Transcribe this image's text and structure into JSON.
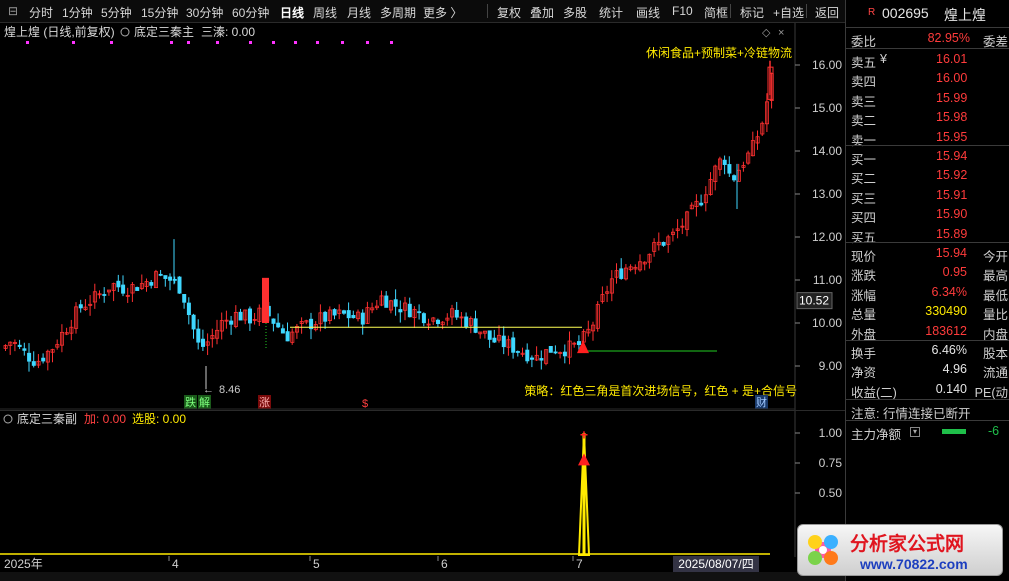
{
  "toolbar": {
    "items": [
      "分时",
      "1分钟",
      "5分钟",
      "15分钟",
      "30分钟",
      "60分钟",
      "日线",
      "周线",
      "月线",
      "多周期",
      "更多 〉",
      "复权",
      "叠加",
      "多股",
      "统计",
      "画线",
      "F10",
      "简框",
      "标记",
      "+自选",
      "返回"
    ],
    "active": "日线"
  },
  "main": {
    "stock_label": "煌上煌 (日线,前复权)",
    "indicator_name": "底定三秦主",
    "indicator_value": "三溱: 0.00",
    "sector_text": "休闲食品+预制菜+冷链物流",
    "strategy_text": "策略：红色三角是首次进场信号，红色 + 是+合信号",
    "low_label": "8.46",
    "current_price_tag": "10.52",
    "signal_labels": {
      "die": "跌",
      "jie": "解",
      "zhang": "涨",
      "s": "$",
      "cai": "财"
    },
    "price_axis": [
      "16.00",
      "15.00",
      "14.00",
      "13.00",
      "12.00",
      "11.00",
      "10.00",
      "9.00"
    ],
    "colors": {
      "up": "#ff3030",
      "down": "#3fd7ff",
      "support": "#ffff55",
      "signal_line": "#22cc22",
      "magenta": "#ff33ff"
    }
  },
  "sub": {
    "indicator_name": "底定三秦副",
    "add_label": "加: 0.00",
    "pick_label": "选股: 0.00",
    "axis": [
      "1.00",
      "0.75",
      "0.50"
    ]
  },
  "date_axis": {
    "labels": [
      "2025年",
      "4",
      "5",
      "6",
      "7"
    ],
    "cursor_date": "2025/08/07/四"
  },
  "quote": {
    "badge": "R",
    "code": "002695",
    "name": "煌上煌",
    "weibi_label": "委比",
    "weibi_value": "82.95%",
    "weicha_label": "委差",
    "asks": [
      {
        "label": "卖五",
        "price": "16.01",
        "extra": "¥"
      },
      {
        "label": "卖四",
        "price": "16.00"
      },
      {
        "label": "卖三",
        "price": "15.99"
      },
      {
        "label": "卖二",
        "price": "15.98"
      },
      {
        "label": "卖一",
        "price": "15.95"
      }
    ],
    "bids": [
      {
        "label": "买一",
        "price": "15.94"
      },
      {
        "label": "买二",
        "price": "15.92"
      },
      {
        "label": "买三",
        "price": "15.91"
      },
      {
        "label": "买四",
        "price": "15.90"
      },
      {
        "label": "买五",
        "price": "15.89"
      }
    ],
    "stats": [
      {
        "label": "现价",
        "value": "15.94",
        "label2": "今开",
        "color": "red"
      },
      {
        "label": "涨跌",
        "value": "0.95",
        "label2": "最高",
        "color": "red"
      },
      {
        "label": "涨幅",
        "value": "6.34%",
        "label2": "最低",
        "color": "red"
      },
      {
        "label": "总量",
        "value": "330490",
        "label2": "量比",
        "color": "yellow"
      },
      {
        "label": "外盘",
        "value": "183612",
        "label2": "内盘",
        "color": "red"
      }
    ],
    "stats2": [
      {
        "label": "换手",
        "value": "6.46%",
        "label2": "股本",
        "color": "white"
      },
      {
        "label": "净资",
        "value": "4.96",
        "label2": "流通",
        "color": "white"
      },
      {
        "label": "收益(二)",
        "value": "0.140",
        "label2": "PE(动",
        "color": "white"
      }
    ],
    "notice": "注意: 行情连接已断开",
    "main_flow_label": "主力净额",
    "main_flow_value": "-6"
  },
  "logo": {
    "title": "分析家公式网",
    "url": "www.70822.com"
  }
}
